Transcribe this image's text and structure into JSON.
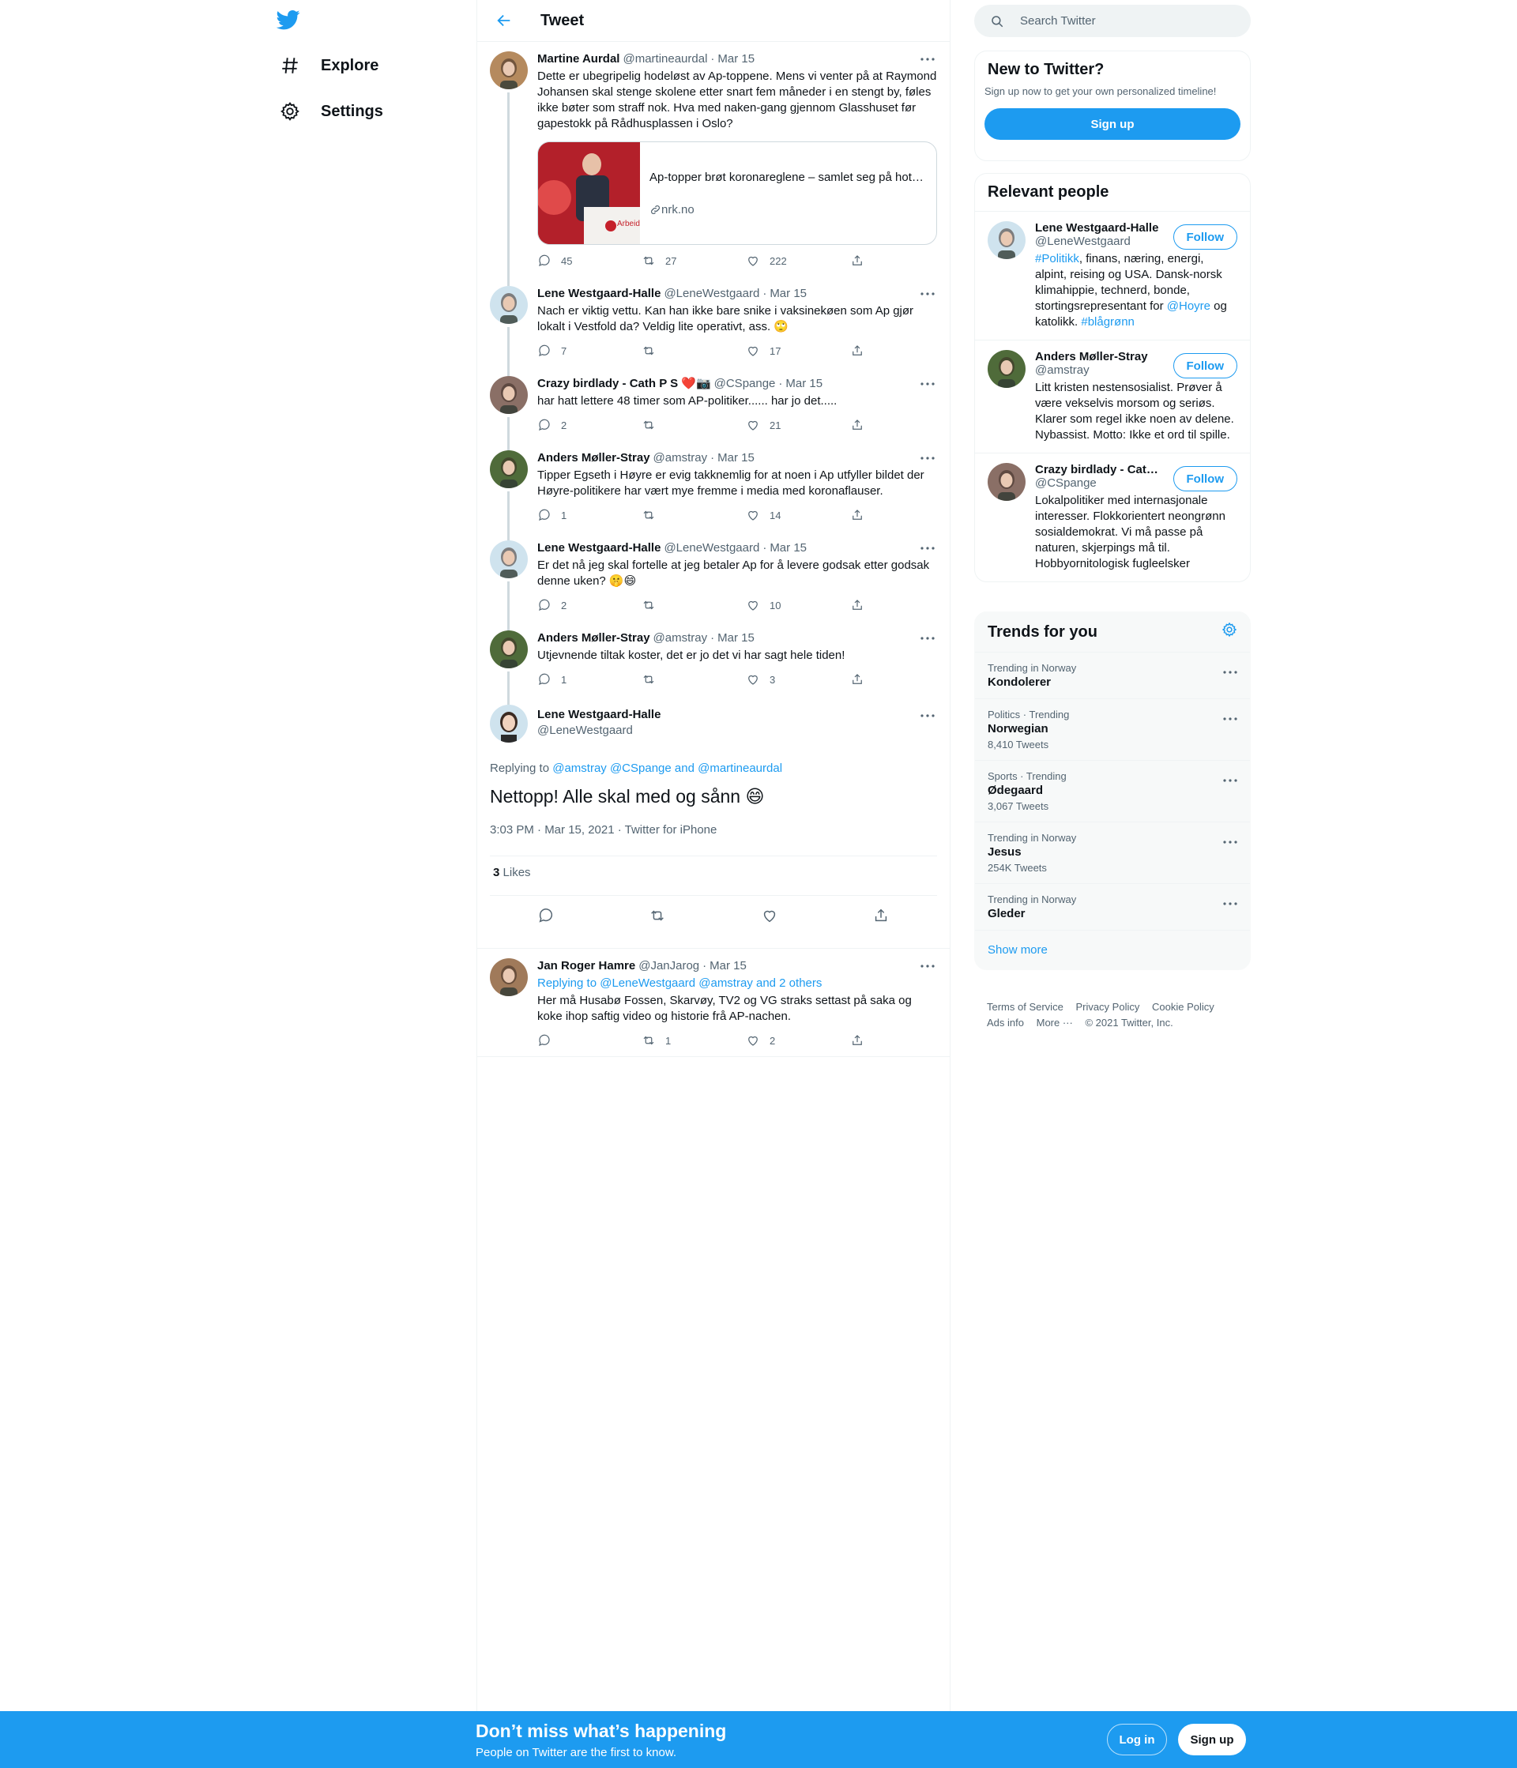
{
  "nav": {
    "items": [
      {
        "label": "Explore",
        "icon": "hashtag-icon"
      },
      {
        "label": "Settings",
        "icon": "gear-icon"
      }
    ]
  },
  "header": {
    "title": "Tweet"
  },
  "thread": [
    {
      "name": "Martine Aurdal",
      "handle": "@martineaurdal",
      "date": "Mar 15",
      "text": "Dette er ubegripelig hodeløst av Ap-toppene. Mens vi venter på at Raymond Johansen skal stenge skolene etter snart fem måneder i en stengt by, føles ikke bøter som straff nok. Hva med naken-gang gjennom Glasshuset før gapestokk på Rådhusplassen i Oslo?",
      "card": {
        "title": "Ap-topper brøt koronareglene – samlet seg på hotell…",
        "site": "nrk.no",
        "image_text": "Arbeide"
      },
      "replies": "45",
      "retweets": "27",
      "likes": "222",
      "avatar_color": "#b58a5e"
    },
    {
      "name": "Lene Westgaard-Halle",
      "handle": "@LeneWestgaard",
      "date": "Mar 15",
      "text": "Nach er viktig vettu. Kan han ikke bare snike i vaksinekøen som Ap gjør lokalt i Vestfold da? Veldig lite operativt, ass. 🙄",
      "replies": "7",
      "retweets": "",
      "likes": "17",
      "avatar_color": "#cfe3ee"
    },
    {
      "name": "Crazy birdlady - Cath P S ❤️📷",
      "handle": "@CSpange",
      "date": "Mar 15",
      "text": "har hatt lettere 48 timer som AP-politiker...... har jo det.....",
      "replies": "2",
      "retweets": "",
      "likes": "21",
      "avatar_color": "#8a6f66"
    },
    {
      "name": "Anders Møller-Stray",
      "handle": "@amstray",
      "date": "Mar 15",
      "text": "Tipper Egseth i Høyre er evig takknemlig for at noen i Ap utfyller bildet der Høyre-politikere har vært mye fremme i media med koronaflauser.",
      "replies": "1",
      "retweets": "",
      "likes": "14",
      "avatar_color": "#4f6b3a"
    },
    {
      "name": "Lene Westgaard-Halle",
      "handle": "@LeneWestgaard",
      "date": "Mar 15",
      "text": "Er det nå jeg skal fortelle at jeg betaler Ap for å levere godsak etter godsak denne uken? 🤫😄",
      "replies": "2",
      "retweets": "",
      "likes": "10",
      "avatar_color": "#cfe3ee"
    },
    {
      "name": "Anders Møller-Stray",
      "handle": "@amstray",
      "date": "Mar 15",
      "text": "Utjevnende tiltak koster, det er jo det vi har sagt hele tiden!",
      "replies": "1",
      "retweets": "",
      "likes": "3",
      "avatar_color": "#4f6b3a"
    }
  ],
  "focus": {
    "name": "Lene Westgaard-Halle",
    "handle": "@LeneWestgaard",
    "replying_prefix": "Replying to ",
    "replying_to": "@amstray @CSpange and @martineaurdal",
    "text": "Nettopp! Alle skal med og sånn 😄",
    "meta": "3:03 PM · Mar 15, 2021 · Twitter for iPhone",
    "likes_count": "3",
    "likes_label": "Likes"
  },
  "reply": {
    "name": "Jan Roger Hamre",
    "handle": "@JanJarog",
    "date": "Mar 15",
    "replying_prefix": "Replying to ",
    "replying_to": "@LeneWestgaard @amstray and 2 others",
    "text": "Her må Husabø Fossen, Skarvøy, TV2 og VG straks settast på saka og koke ihop saftig video og historie frå AP-nachen.",
    "replies": "",
    "retweets": "1",
    "likes": "2",
    "avatar_color": "#a07a5a"
  },
  "search": {
    "placeholder": "Search Twitter"
  },
  "new_to_twitter": {
    "title": "New to Twitter?",
    "subtitle": "Sign up now to get your own personalized timeline!",
    "button": "Sign up"
  },
  "relevant": {
    "title": "Relevant people",
    "follow_label": "Follow",
    "people": [
      {
        "name": "Lene Westgaard-Halle",
        "handle": "@LeneWestgaard",
        "bio_parts": [
          {
            "t": "#Politikk",
            "link": true
          },
          {
            "t": ", finans, næring, energi, alpint, reising og USA. Dansk-norsk klimahippie, technerd, bonde, stortingsrepresentant for ",
            "link": false
          },
          {
            "t": "@Hoyre",
            "link": true
          },
          {
            "t": " og katolikk. ",
            "link": false
          },
          {
            "t": "#blågrønn",
            "link": true
          }
        ],
        "avatar_color": "#cfe3ee"
      },
      {
        "name": "Anders Møller-Stray",
        "handle": "@amstray",
        "bio_parts": [
          {
            "t": "Litt kristen nestensosialist. Prøver å være vekselvis morsom og seriøs. Klarer som regel ikke noen av delene. Nybassist. Motto: Ikke et ord til spille.",
            "link": false
          }
        ],
        "avatar_color": "#4f6b3a"
      },
      {
        "name": "Crazy birdlady - Cat…",
        "handle": "@CSpange",
        "bio_parts": [
          {
            "t": "Lokalpolitiker med internasjonale interesser. Flokkorientert neongrønn sosialdemokrat. Vi må passe på naturen, skjerpings må til. Hobbyornitologisk fugleelsker",
            "link": false
          }
        ],
        "avatar_color": "#8a6f66"
      }
    ]
  },
  "trends": {
    "title": "Trends for you",
    "items": [
      {
        "context": "Trending in Norway",
        "name": "Kondolerer",
        "count": ""
      },
      {
        "context": "Politics · Trending",
        "name": "Norwegian",
        "count": "8,410 Tweets"
      },
      {
        "context": "Sports · Trending",
        "name": "Ødegaard",
        "count": "3,067 Tweets"
      },
      {
        "context": "Trending in Norway",
        "name": "Jesus",
        "count": "254K Tweets"
      },
      {
        "context": "Trending in Norway",
        "name": "Gleder",
        "count": ""
      }
    ],
    "show_more": "Show more"
  },
  "footer": {
    "links": [
      "Terms of Service",
      "Privacy Policy",
      "Cookie Policy",
      "Ads info",
      "More ···"
    ],
    "copyright": "© 2021 Twitter, Inc."
  },
  "bottom_bar": {
    "title": "Don’t miss what’s happening",
    "subtitle": "People on Twitter are the first to know.",
    "login": "Log in",
    "signup": "Sign up"
  },
  "colors": {
    "accent": "#1d9bf0",
    "text": "#0f1419",
    "muted": "#536471",
    "border": "#eff3f4"
  }
}
